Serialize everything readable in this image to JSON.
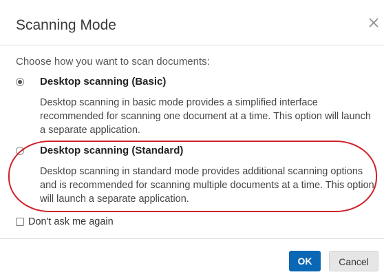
{
  "dialog": {
    "title": "Scanning Mode",
    "close_icon": "close-icon"
  },
  "prompt": "Choose how you want to scan documents:",
  "options": [
    {
      "label": "Desktop scanning (Basic)",
      "description": "Desktop scanning in basic mode provides a simplified interface recommended for scanning one document at a time. This option will launch a separate application.",
      "selected": true
    },
    {
      "label": "Desktop scanning (Standard)",
      "description": "Desktop scanning in standard mode provides additional scanning options and is recommended for scanning multiple documents at a time. This option will launch a separate application.",
      "selected": false
    }
  ],
  "dont_ask": {
    "label": "Don't ask me again",
    "checked": false
  },
  "buttons": {
    "ok_label": "OK",
    "cancel_label": "Cancel"
  },
  "colors": {
    "primary": "#0a67b6",
    "highlight_ring": "#d0202a"
  }
}
